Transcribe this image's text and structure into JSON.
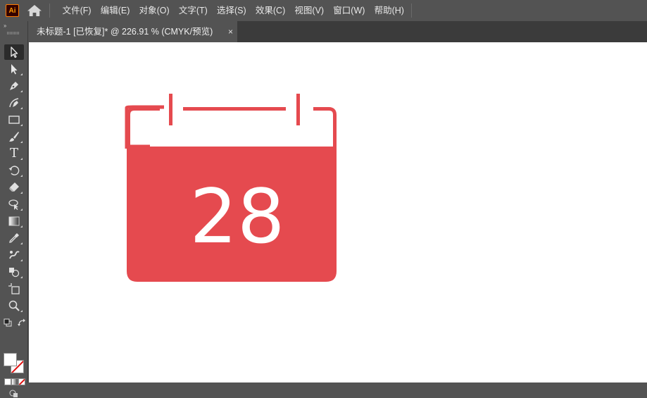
{
  "app": {
    "logo_text": "Ai"
  },
  "menu": [
    {
      "label": "文件(F)"
    },
    {
      "label": "编辑(E)"
    },
    {
      "label": "对象(O)"
    },
    {
      "label": "文字(T)"
    },
    {
      "label": "选择(S)"
    },
    {
      "label": "效果(C)"
    },
    {
      "label": "视图(V)"
    },
    {
      "label": "窗口(W)"
    },
    {
      "label": "帮助(H)"
    }
  ],
  "document_tab": {
    "title": "未标题-1 [已恢复]* @ 226.91 % (CMYK/预览)",
    "close_glyph": "×"
  },
  "toolbar": {
    "collapse_glyph": "››",
    "tools": [
      {
        "name": "selection-tool",
        "icon": "selection-arrow-icon",
        "active": true
      },
      {
        "name": "direct-selection-tool",
        "icon": "direct-selection-icon"
      },
      {
        "name": "pen-tool",
        "icon": "pen-icon"
      },
      {
        "name": "curvature-tool",
        "icon": "curvature-icon"
      },
      {
        "name": "rectangle-tool",
        "icon": "rectangle-icon"
      },
      {
        "name": "paintbrush-tool",
        "icon": "paintbrush-icon"
      },
      {
        "name": "type-tool",
        "icon": "type-icon",
        "glyph": "T"
      },
      {
        "name": "rotate-tool",
        "icon": "rotate-icon"
      },
      {
        "name": "eraser-tool",
        "icon": "eraser-icon"
      },
      {
        "name": "lasso-tool",
        "icon": "lasso-icon"
      },
      {
        "name": "gradient-tool",
        "icon": "gradient-icon"
      },
      {
        "name": "eyedropper-tool",
        "icon": "eyedropper-icon"
      },
      {
        "name": "puppet-warp-tool",
        "icon": "puppet-warp-icon"
      },
      {
        "name": "shape-builder-tool",
        "icon": "shape-builder-icon"
      },
      {
        "name": "artboard-tool",
        "icon": "artboard-icon"
      },
      {
        "name": "zoom-tool",
        "icon": "zoom-icon"
      }
    ],
    "fill_color": "#ffffff",
    "stroke": "none"
  },
  "canvas": {
    "artwork": {
      "type": "calendar-icon",
      "date_text": "28",
      "color": "#e54a4f"
    }
  }
}
